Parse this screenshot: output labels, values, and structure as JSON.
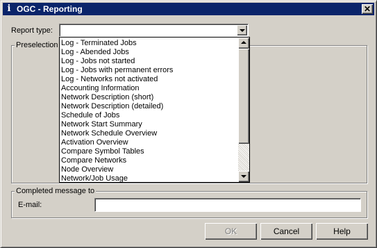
{
  "window": {
    "title": "OGC - Reporting",
    "app_icon": "info-i-icon",
    "close_glyph": "✕"
  },
  "report_type": {
    "label": "Report type:",
    "value": ""
  },
  "preselection": {
    "caption": "Preselection"
  },
  "dropdown": {
    "items": [
      "Log - Terminated Jobs",
      "Log - Abended Jobs",
      "Log - Jobs not started",
      "Log - Jobs with permanent errors",
      "Log - Networks not activated",
      "Accounting Information",
      "Network Description (short)",
      "Network Description (detailed)",
      "Schedule of Jobs",
      "Network Start Summary",
      "Network Schedule Overview",
      "Activation Overview",
      "Compare Symbol Tables",
      "Compare Networks",
      "Node Overview",
      "Network/Job Usage"
    ]
  },
  "completed": {
    "caption": "Completed message to",
    "email_label": "E-mail:",
    "email_value": ""
  },
  "buttons": {
    "ok": "OK",
    "cancel": "Cancel",
    "help": "Help"
  },
  "colors": {
    "titlebar": "#0a246a",
    "face": "#d4d0c8"
  }
}
